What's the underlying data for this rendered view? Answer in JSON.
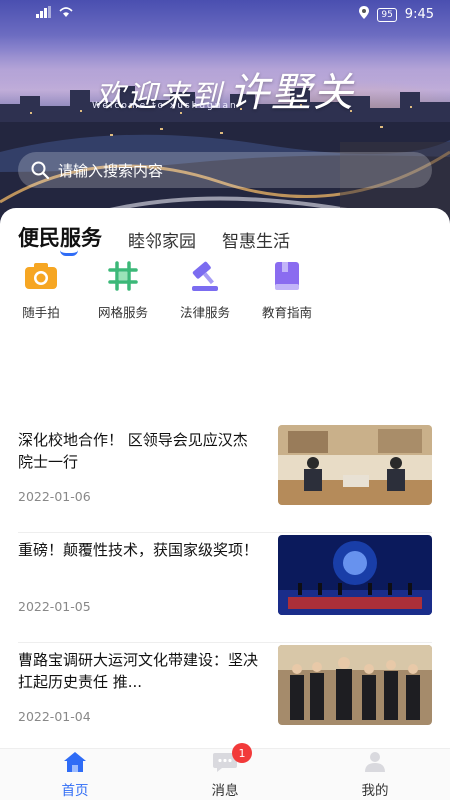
{
  "status_bar": {
    "battery": "95",
    "time": "9:45"
  },
  "hero": {
    "welcome_text": "欢迎来到",
    "city_text": "许墅关",
    "welcome_sub": "Welcome  to  xushuguan",
    "search_placeholder": "请输入搜索内容"
  },
  "tabs": [
    {
      "label": "便民服务",
      "active": true
    },
    {
      "label": "睦邻家园",
      "active": false
    },
    {
      "label": "智惠生活",
      "active": false
    }
  ],
  "services": [
    {
      "label": "随手拍",
      "icon": "camera-icon",
      "color": "#f6a623"
    },
    {
      "label": "网格服务",
      "icon": "grid-icon",
      "color": "#3cb878"
    },
    {
      "label": "法律服务",
      "icon": "gavel-icon",
      "color": "#7b6cf0"
    },
    {
      "label": "教育指南",
      "icon": "book-icon",
      "color": "#8a6cf0"
    }
  ],
  "news": [
    {
      "title": "深化校地合作！ 区领导会见应汉杰院士一行",
      "date": "2022-01-06"
    },
    {
      "title": "重磅！颠覆性技术，获国家级奖项！",
      "date": "2022-01-05"
    },
    {
      "title": "曹路宝调研大运河文化带建设：坚决扛起历史责任 推...",
      "date": "2022-01-04"
    }
  ],
  "bottom_nav": [
    {
      "label": "首页",
      "icon": "home-icon",
      "active": true
    },
    {
      "label": "消息",
      "icon": "message-icon",
      "badge": "1"
    },
    {
      "label": "我的",
      "icon": "profile-icon"
    }
  ],
  "colors": {
    "accent": "#2f6cf6",
    "badge": "#f23a3a"
  }
}
